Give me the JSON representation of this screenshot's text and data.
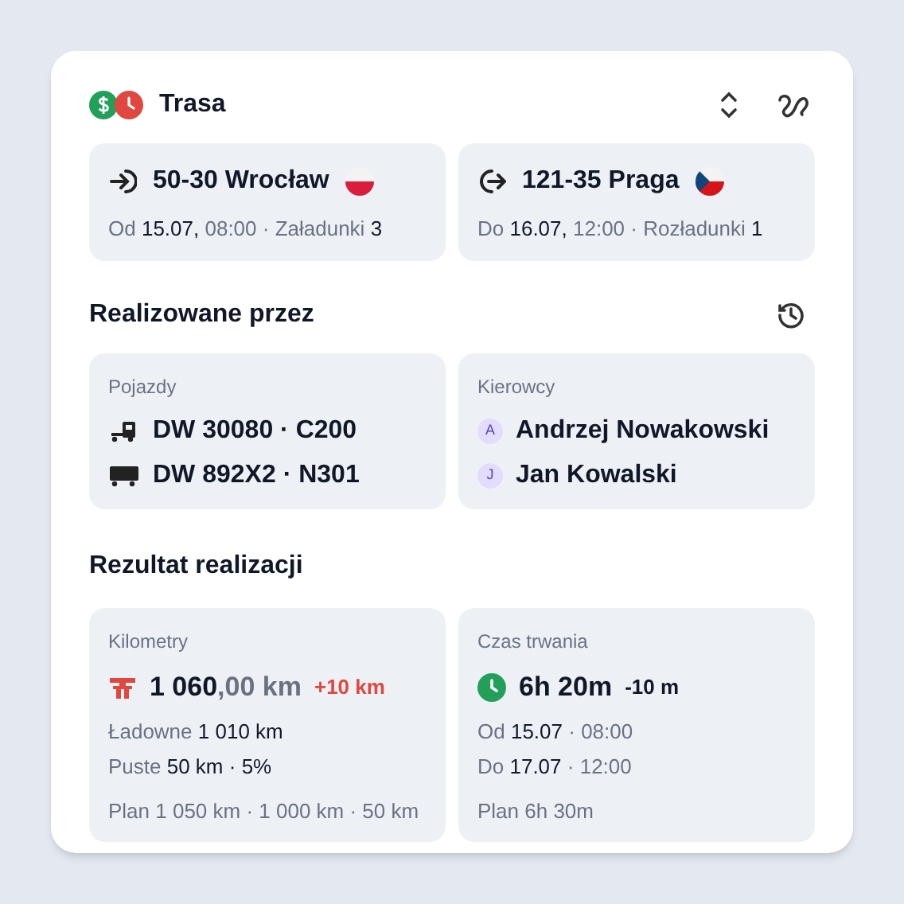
{
  "route": {
    "title": "Trasa",
    "stops": [
      {
        "kind": "load",
        "flag": {
          "kind": "pl"
        },
        "place": "50-30 Wrocław",
        "detail": "Od **15.07,** 08:00 · Załadunki **3**"
      },
      {
        "kind": "unload",
        "flag": {
          "kind": "cz"
        },
        "place": "121-35 Praga",
        "detail": "Do **16.07,** 12:00 · Rozładunki **1**"
      }
    ]
  },
  "assigned": {
    "title": "Realizowane przez",
    "vehicles": {
      "label": "Pojazdy",
      "items": [
        {
          "kind": "tractor",
          "plate": "DW 30080 · C200"
        },
        {
          "kind": "trailer",
          "plate": "DW 892X2 · N301"
        }
      ]
    },
    "drivers": {
      "label": "Kierowcy",
      "items": [
        {
          "initial": "A",
          "name": "Andrzej Nowakowski"
        },
        {
          "initial": "J",
          "name": "Jan Kowalski"
        }
      ]
    }
  },
  "result": {
    "title": "Rezultat realizacji",
    "metrics": [
      {
        "kind": "road",
        "label": "Kilometry",
        "value": "**1 060**,00 km",
        "delta": {
          "text": "+10 km",
          "kind": "over"
        },
        "lines": [
          "Ładowne **1 010 km**",
          "Puste **50 km · 5%**"
        ],
        "plan": "Plan 1 050 km · 1 000 km · 50 km"
      },
      {
        "kind": "clock",
        "label": "Czas trwania",
        "value": "**6h 20m**",
        "delta": {
          "text": "-10 m",
          "kind": "under"
        },
        "lines": [
          "Od **15.07** · 08:00",
          "Do **17.07** · 12:00"
        ],
        "plan": "Plan 6h 30m"
      }
    ]
  }
}
